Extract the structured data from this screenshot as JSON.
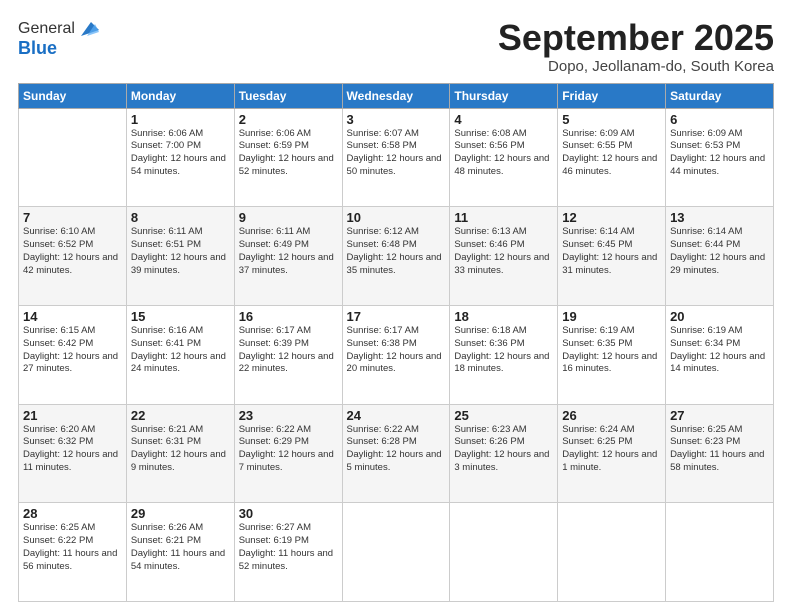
{
  "logo": {
    "general": "General",
    "blue": "Blue"
  },
  "title": "September 2025",
  "subtitle": "Dopo, Jeollanam-do, South Korea",
  "headers": [
    "Sunday",
    "Monday",
    "Tuesday",
    "Wednesday",
    "Thursday",
    "Friday",
    "Saturday"
  ],
  "weeks": [
    [
      {
        "day": "",
        "sunrise": "",
        "sunset": "",
        "daylight": ""
      },
      {
        "day": "1",
        "sunrise": "Sunrise: 6:06 AM",
        "sunset": "Sunset: 7:00 PM",
        "daylight": "Daylight: 12 hours and 54 minutes."
      },
      {
        "day": "2",
        "sunrise": "Sunrise: 6:06 AM",
        "sunset": "Sunset: 6:59 PM",
        "daylight": "Daylight: 12 hours and 52 minutes."
      },
      {
        "day": "3",
        "sunrise": "Sunrise: 6:07 AM",
        "sunset": "Sunset: 6:58 PM",
        "daylight": "Daylight: 12 hours and 50 minutes."
      },
      {
        "day": "4",
        "sunrise": "Sunrise: 6:08 AM",
        "sunset": "Sunset: 6:56 PM",
        "daylight": "Daylight: 12 hours and 48 minutes."
      },
      {
        "day": "5",
        "sunrise": "Sunrise: 6:09 AM",
        "sunset": "Sunset: 6:55 PM",
        "daylight": "Daylight: 12 hours and 46 minutes."
      },
      {
        "day": "6",
        "sunrise": "Sunrise: 6:09 AM",
        "sunset": "Sunset: 6:53 PM",
        "daylight": "Daylight: 12 hours and 44 minutes."
      }
    ],
    [
      {
        "day": "7",
        "sunrise": "Sunrise: 6:10 AM",
        "sunset": "Sunset: 6:52 PM",
        "daylight": "Daylight: 12 hours and 42 minutes."
      },
      {
        "day": "8",
        "sunrise": "Sunrise: 6:11 AM",
        "sunset": "Sunset: 6:51 PM",
        "daylight": "Daylight: 12 hours and 39 minutes."
      },
      {
        "day": "9",
        "sunrise": "Sunrise: 6:11 AM",
        "sunset": "Sunset: 6:49 PM",
        "daylight": "Daylight: 12 hours and 37 minutes."
      },
      {
        "day": "10",
        "sunrise": "Sunrise: 6:12 AM",
        "sunset": "Sunset: 6:48 PM",
        "daylight": "Daylight: 12 hours and 35 minutes."
      },
      {
        "day": "11",
        "sunrise": "Sunrise: 6:13 AM",
        "sunset": "Sunset: 6:46 PM",
        "daylight": "Daylight: 12 hours and 33 minutes."
      },
      {
        "day": "12",
        "sunrise": "Sunrise: 6:14 AM",
        "sunset": "Sunset: 6:45 PM",
        "daylight": "Daylight: 12 hours and 31 minutes."
      },
      {
        "day": "13",
        "sunrise": "Sunrise: 6:14 AM",
        "sunset": "Sunset: 6:44 PM",
        "daylight": "Daylight: 12 hours and 29 minutes."
      }
    ],
    [
      {
        "day": "14",
        "sunrise": "Sunrise: 6:15 AM",
        "sunset": "Sunset: 6:42 PM",
        "daylight": "Daylight: 12 hours and 27 minutes."
      },
      {
        "day": "15",
        "sunrise": "Sunrise: 6:16 AM",
        "sunset": "Sunset: 6:41 PM",
        "daylight": "Daylight: 12 hours and 24 minutes."
      },
      {
        "day": "16",
        "sunrise": "Sunrise: 6:17 AM",
        "sunset": "Sunset: 6:39 PM",
        "daylight": "Daylight: 12 hours and 22 minutes."
      },
      {
        "day": "17",
        "sunrise": "Sunrise: 6:17 AM",
        "sunset": "Sunset: 6:38 PM",
        "daylight": "Daylight: 12 hours and 20 minutes."
      },
      {
        "day": "18",
        "sunrise": "Sunrise: 6:18 AM",
        "sunset": "Sunset: 6:36 PM",
        "daylight": "Daylight: 12 hours and 18 minutes."
      },
      {
        "day": "19",
        "sunrise": "Sunrise: 6:19 AM",
        "sunset": "Sunset: 6:35 PM",
        "daylight": "Daylight: 12 hours and 16 minutes."
      },
      {
        "day": "20",
        "sunrise": "Sunrise: 6:19 AM",
        "sunset": "Sunset: 6:34 PM",
        "daylight": "Daylight: 12 hours and 14 minutes."
      }
    ],
    [
      {
        "day": "21",
        "sunrise": "Sunrise: 6:20 AM",
        "sunset": "Sunset: 6:32 PM",
        "daylight": "Daylight: 12 hours and 11 minutes."
      },
      {
        "day": "22",
        "sunrise": "Sunrise: 6:21 AM",
        "sunset": "Sunset: 6:31 PM",
        "daylight": "Daylight: 12 hours and 9 minutes."
      },
      {
        "day": "23",
        "sunrise": "Sunrise: 6:22 AM",
        "sunset": "Sunset: 6:29 PM",
        "daylight": "Daylight: 12 hours and 7 minutes."
      },
      {
        "day": "24",
        "sunrise": "Sunrise: 6:22 AM",
        "sunset": "Sunset: 6:28 PM",
        "daylight": "Daylight: 12 hours and 5 minutes."
      },
      {
        "day": "25",
        "sunrise": "Sunrise: 6:23 AM",
        "sunset": "Sunset: 6:26 PM",
        "daylight": "Daylight: 12 hours and 3 minutes."
      },
      {
        "day": "26",
        "sunrise": "Sunrise: 6:24 AM",
        "sunset": "Sunset: 6:25 PM",
        "daylight": "Daylight: 12 hours and 1 minute."
      },
      {
        "day": "27",
        "sunrise": "Sunrise: 6:25 AM",
        "sunset": "Sunset: 6:23 PM",
        "daylight": "Daylight: 11 hours and 58 minutes."
      }
    ],
    [
      {
        "day": "28",
        "sunrise": "Sunrise: 6:25 AM",
        "sunset": "Sunset: 6:22 PM",
        "daylight": "Daylight: 11 hours and 56 minutes."
      },
      {
        "day": "29",
        "sunrise": "Sunrise: 6:26 AM",
        "sunset": "Sunset: 6:21 PM",
        "daylight": "Daylight: 11 hours and 54 minutes."
      },
      {
        "day": "30",
        "sunrise": "Sunrise: 6:27 AM",
        "sunset": "Sunset: 6:19 PM",
        "daylight": "Daylight: 11 hours and 52 minutes."
      },
      {
        "day": "",
        "sunrise": "",
        "sunset": "",
        "daylight": ""
      },
      {
        "day": "",
        "sunrise": "",
        "sunset": "",
        "daylight": ""
      },
      {
        "day": "",
        "sunrise": "",
        "sunset": "",
        "daylight": ""
      },
      {
        "day": "",
        "sunrise": "",
        "sunset": "",
        "daylight": ""
      }
    ]
  ]
}
